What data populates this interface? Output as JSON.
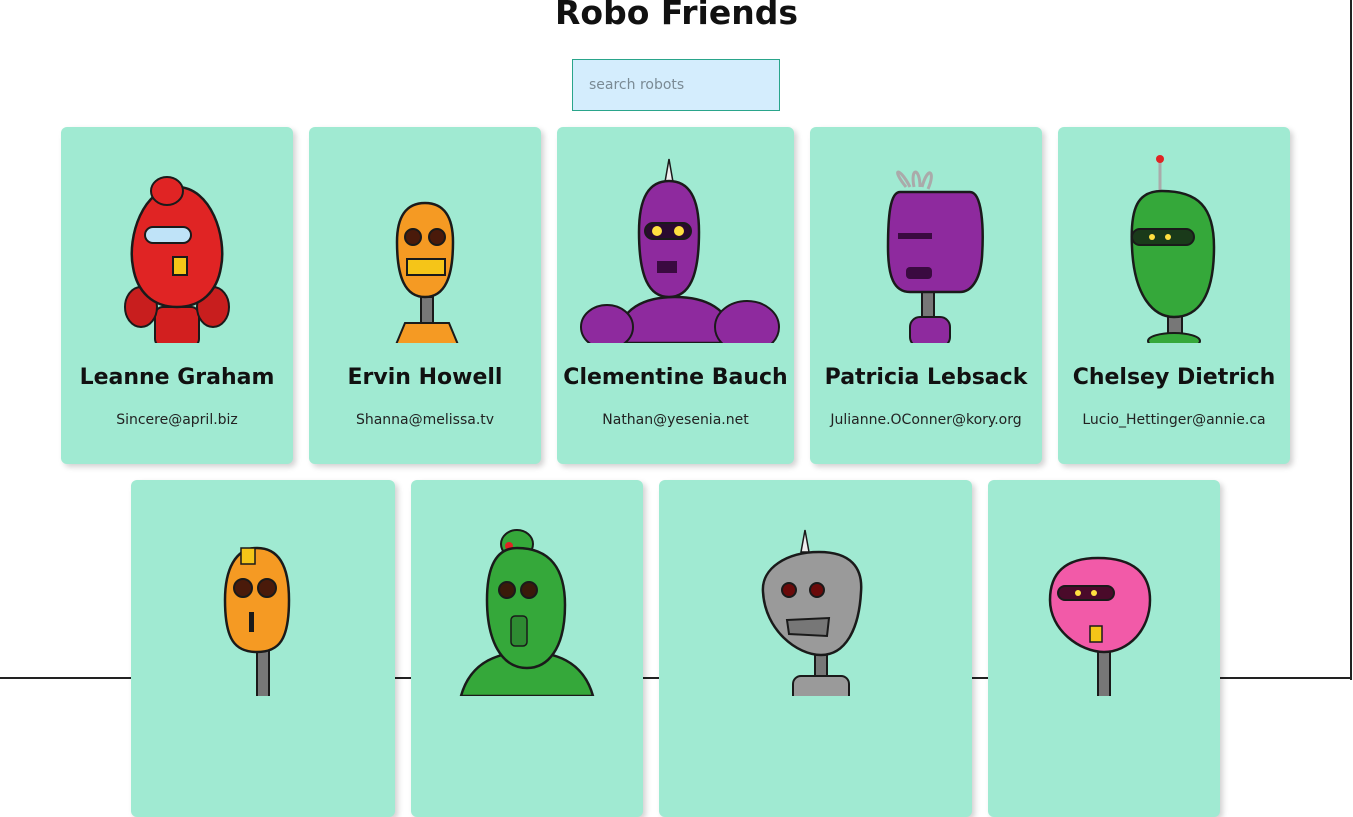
{
  "header": {
    "title": "Robo Friends"
  },
  "search": {
    "placeholder": "search robots",
    "value": ""
  },
  "robots": [
    {
      "name": "Leanne Graham",
      "email": "Sincere@april.biz",
      "color": "#e02424",
      "icon": "robot-red"
    },
    {
      "name": "Ervin Howell",
      "email": "Shanna@melissa.tv",
      "color": "#f59a23",
      "icon": "robot-orange"
    },
    {
      "name": "Clementine Bauch",
      "email": "Nathan@yesenia.net",
      "color": "#8e2a9e",
      "icon": "robot-purple"
    },
    {
      "name": "Patricia Lebsack",
      "email": "Julianne.OConner@kory.org",
      "color": "#8e2a9e",
      "icon": "robot-purple"
    },
    {
      "name": "Chelsey Dietrich",
      "email": "Lucio_Hettinger@annie.ca",
      "color": "#35a83a",
      "icon": "robot-green"
    },
    {
      "name": "",
      "email": "",
      "color": "#f59a23",
      "icon": "robot-orange"
    },
    {
      "name": "",
      "email": "",
      "color": "#35a83a",
      "icon": "robot-green"
    },
    {
      "name": "",
      "email": "",
      "color": "#9a9a9a",
      "icon": "robot-gray"
    },
    {
      "name": "",
      "email": "",
      "color": "#f25aa8",
      "icon": "robot-pink"
    }
  ],
  "colors": {
    "card_bg": "#a0ead2",
    "search_bg": "#d4edfd",
    "search_border": "#2aa58b"
  }
}
